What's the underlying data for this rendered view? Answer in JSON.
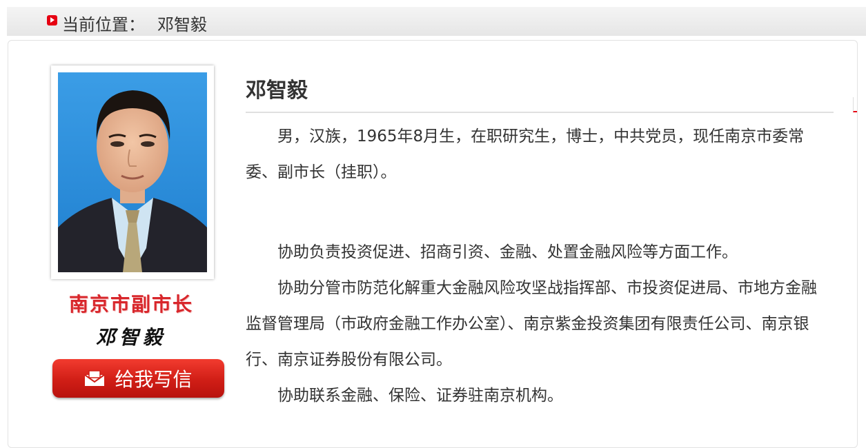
{
  "breadcrumb": {
    "label": "当前位置：",
    "current": "邓智毅"
  },
  "profile": {
    "name": "邓智毅",
    "title_image_text": "南京市副市长",
    "signature": "邓智毅",
    "write_button_label": "给我写信"
  },
  "content": {
    "paragraphs": [
      "男，汉族，1965年8月生，在职研究生，博士，中共党员，现任南京市委常委、副市长（挂职）。",
      "协助负责投资促进、招商引资、金融、处置金融风险等方面工作。",
      "协助分管市防范化解重大金融风险攻坚战指挥部、市投资促进局、市地方金融监督管理局（市政府金融工作办公室）、南京紫金投资集团有限责任公司、南京银行、南京证券股份有限公司。",
      "协助联系金融、保险、证券驻南京机构。"
    ]
  },
  "colors": {
    "accent_red": "#e60012",
    "button_red": "#d01e16",
    "photo_background": "#2f93de"
  }
}
